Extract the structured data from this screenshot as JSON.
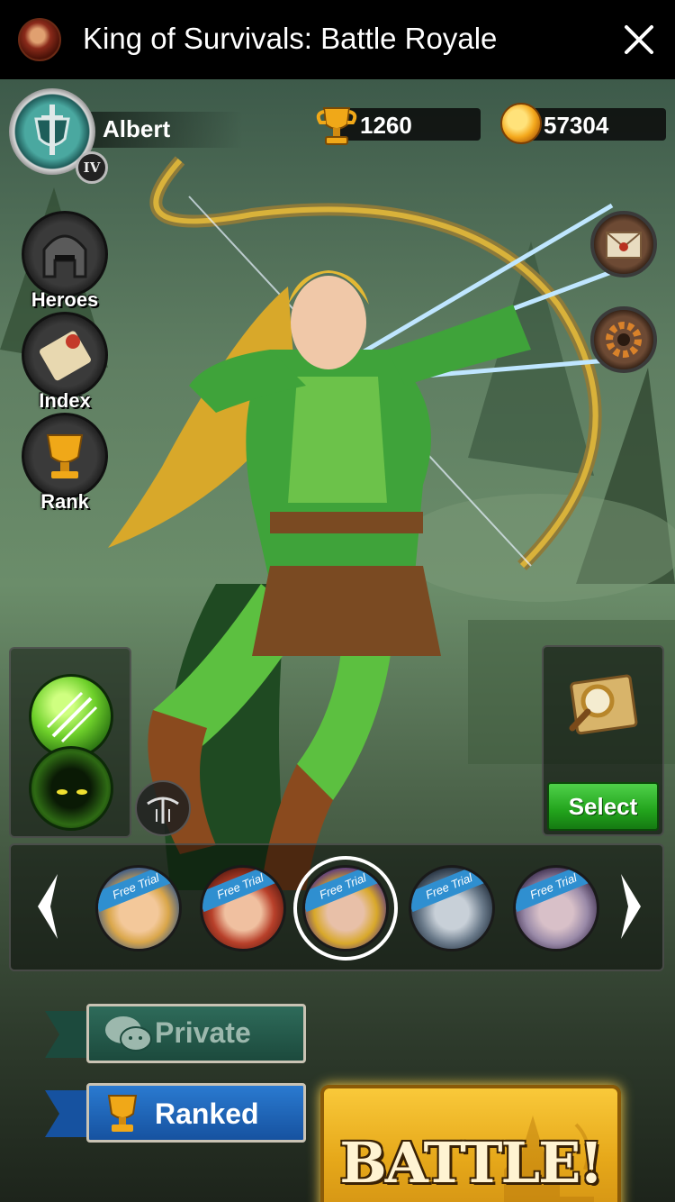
{
  "app": {
    "title": "King of Survivals: Battle Royale",
    "close_icon": "close-icon"
  },
  "player": {
    "name": "Albert",
    "rank_level": "IV"
  },
  "currency": {
    "trophies": "1260",
    "coins": "57304"
  },
  "menu": [
    {
      "label": "Heroes",
      "icon": "helmet-icon"
    },
    {
      "label": "Index",
      "icon": "scroll-icon"
    },
    {
      "label": "Rank",
      "icon": "trophy-icon"
    }
  ],
  "side_buttons": [
    {
      "icon": "mail-icon"
    },
    {
      "icon": "gear-icon"
    }
  ],
  "map_panel": {
    "select_label": "Select",
    "icon": "magnifier-map-icon"
  },
  "carousel": {
    "heroes": [
      {
        "tag": "Free Trial",
        "name": "hero-blonde-girl",
        "selected": false
      },
      {
        "tag": "Free Trial",
        "name": "hero-red-hood",
        "selected": false
      },
      {
        "tag": "Free Trial",
        "name": "hero-elf-archer",
        "selected": true
      },
      {
        "tag": "Free Trial",
        "name": "hero-werewolf",
        "selected": false
      },
      {
        "tag": "Free Trial",
        "name": "hero-dark-elf",
        "selected": false
      }
    ]
  },
  "modes": {
    "private_label": "Private",
    "ranked_label": "Ranked"
  },
  "battle": {
    "label": "BATTLE!"
  },
  "colors": {
    "accent_gold": "#f4b61c",
    "select_green": "#22a31c",
    "ranked_blue": "#1e66c0",
    "private_green": "#1c4a3d"
  }
}
